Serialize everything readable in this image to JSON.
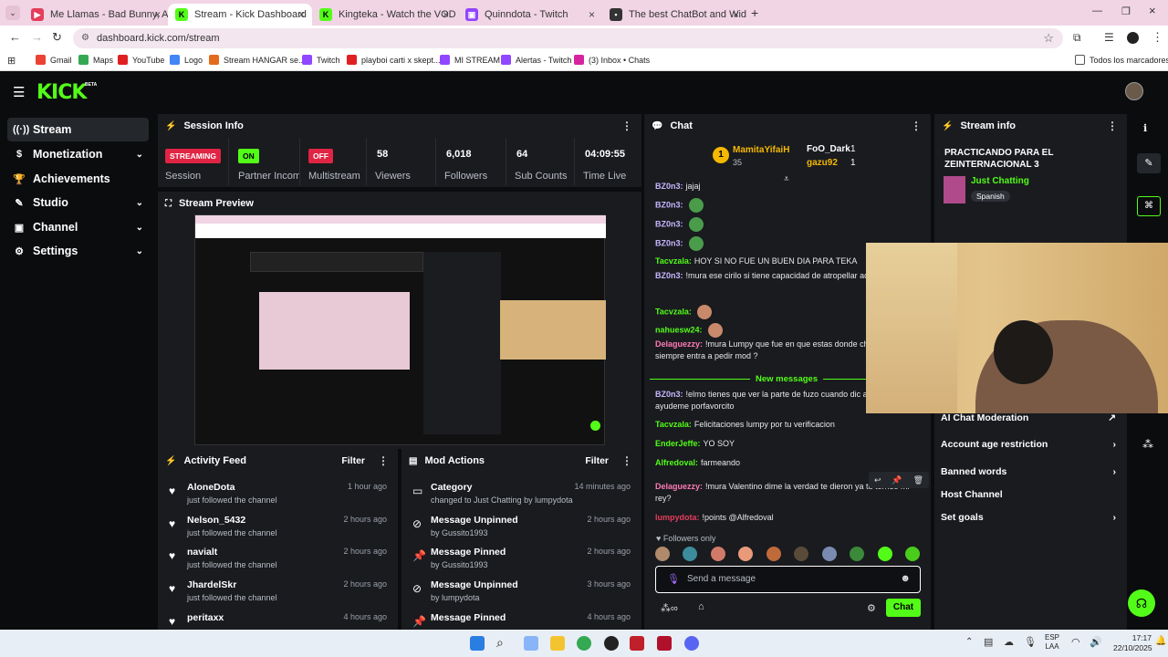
{
  "browser": {
    "tabs": [
      {
        "label": "Me Llamas - Bad Bunny, Arcang",
        "color": "#e43d5b"
      },
      {
        "label": "Stream - Kick Dashboard",
        "color": "#53fc18",
        "active": true
      },
      {
        "label": "Kingteka - Watch the VOD",
        "color": "#53fc18"
      },
      {
        "label": "Quinndota - Twitch",
        "color": "#9146ff"
      },
      {
        "label": "The best ChatBot and Widgets",
        "color": "#333"
      }
    ],
    "url": "dashboard.kick.com/stream",
    "bookmarks": [
      "Gmail",
      "Maps",
      "YouTube",
      "Logo",
      "Stream HANGAR se...",
      "Twitch",
      "playboi carti x skept...",
      "MI STREAM",
      "Alertas - Twitch",
      "(3) Inbox • Chats"
    ],
    "bookmarks_folder": "Todos los marcadores"
  },
  "app": {
    "logo": "KICK",
    "logo_beta": "BETA",
    "sidebar": [
      {
        "label": "Stream",
        "active": true
      },
      {
        "label": "Monetization",
        "chev": true
      },
      {
        "label": "Achievements"
      },
      {
        "label": "Studio",
        "chev": true
      },
      {
        "label": "Channel",
        "chev": true
      },
      {
        "label": "Settings",
        "chev": true
      }
    ],
    "session": {
      "title": "Session Info",
      "stats": [
        {
          "badge": "STREAMING",
          "label": "Session"
        },
        {
          "badge": "ON",
          "label": "Partner Income"
        },
        {
          "badge": "OFF",
          "label": "Multistream"
        },
        {
          "value": "58",
          "label": "Viewers"
        },
        {
          "value": "6,018",
          "label": "Followers"
        },
        {
          "value": "64",
          "label": "Sub Counts"
        },
        {
          "value": "04:09:55",
          "label": "Time Live"
        }
      ]
    },
    "preview_title": "Stream Preview",
    "activity": {
      "title": "Activity Feed",
      "filter": "Filter",
      "rows": [
        {
          "name": "AloneDota",
          "sub": "just followed the channel",
          "time": "1 hour ago"
        },
        {
          "name": "Nelson_5432",
          "sub": "just followed the channel",
          "time": "2 hours ago"
        },
        {
          "name": "navialt",
          "sub": "just followed the channel",
          "time": "2 hours ago"
        },
        {
          "name": "JhardelSkr",
          "sub": "just followed the channel",
          "time": "2 hours ago"
        },
        {
          "name": "peritaxx",
          "sub": "",
          "time": "4 hours ago"
        }
      ]
    },
    "mod": {
      "title": "Mod Actions",
      "filter": "Filter",
      "rows": [
        {
          "name": "Category",
          "sub": "changed to Just Chatting by lumpydota",
          "time": "14 minutes ago"
        },
        {
          "name": "Message Unpinned",
          "sub": "by Gussito1993",
          "time": "2 hours ago"
        },
        {
          "name": "Message Pinned",
          "sub": "by Gussito1993",
          "time": "2 hours ago"
        },
        {
          "name": "Message Unpinned",
          "sub": "by lumpydota",
          "time": "3 hours ago"
        },
        {
          "name": "Message Pinned",
          "sub": "",
          "time": "4 hours ago"
        }
      ]
    },
    "chat": {
      "title": "Chat",
      "leader1": {
        "name": "MamitaYifaiH",
        "count": "35"
      },
      "leader2": {
        "name": "FoO_Dark",
        "count": "1"
      },
      "leader3": {
        "name": "gazu92",
        "count": "1"
      },
      "rank": "1",
      "messages": [
        {
          "user": "BZ0n3:",
          "text": "jajaj",
          "color": "#c8b6ff"
        },
        {
          "user": "BZ0n3:",
          "text": "",
          "color": "#c8b6ff"
        },
        {
          "user": "BZ0n3:",
          "text": "",
          "color": "#c8b6ff"
        },
        {
          "user": "BZ0n3:",
          "text": "",
          "color": "#c8b6ff"
        },
        {
          "user": "Tacvzala:",
          "text": "HOY SI NO FUE UN BUEN DIA PARA TEKA",
          "color": "#53fc18"
        },
        {
          "user": "BZ0n3:",
          "text": "!mura ese cirilo si tiene capacidad de atropellar adeoof",
          "color": "#c8b6ff"
        },
        {
          "user": "Tacvzala:",
          "text": "",
          "color": "#53fc18"
        },
        {
          "user": "nahuesw24:",
          "text": "",
          "color": "#53fc18"
        },
        {
          "user": "Delaguezzy:",
          "text": "!mura Lumpy que fue en que estas donde chupapinga que siempre entra a pedir mod ?",
          "color": "#ff7ab6"
        },
        {
          "user": "BZ0n3:",
          "text": "!elmo tienes que ver la parte de fuzo cuando dic abogada ayudeme porfavorcito",
          "color": "#c8b6ff"
        },
        {
          "user": "Tacvzala:",
          "text": "Felicitaciones lumpy por tu verificacion",
          "color": "#53fc18"
        },
        {
          "user": "EnderJeffe:",
          "text": "YO SOY",
          "color": "#53fc18"
        },
        {
          "user": "Alfredoval:",
          "text": "farmeando",
          "color": "#53fc18"
        },
        {
          "user": "Delaguezzy:",
          "text": "!mura Valentino dime la verdad te dieron ya tu torneo mi rey?",
          "color": "#ff7ab6"
        },
        {
          "user": "lumpydota:",
          "text": "!points @Alfredoval",
          "color": "#e43d5b"
        }
      ],
      "new_messages": "New messages",
      "followers_only": "Followers only",
      "input_placeholder": "Send a message",
      "send": "Chat"
    },
    "stream_info": {
      "title": "Stream info",
      "stream_title": "PRACTICANDO PARA EL ZEINTERNACIONAL 3",
      "category": "Just Chatting",
      "tag": "Spanish",
      "items": [
        {
          "label": "AI Chat Moderation",
          "chev": "↗"
        },
        {
          "label": "Account age restriction",
          "chev": "›"
        },
        {
          "label": "Banned words",
          "chev": "›"
        },
        {
          "label": "Host Channel",
          "chev": ""
        },
        {
          "label": "Set goals",
          "chev": "›"
        }
      ]
    }
  },
  "taskbar": {
    "lang": "ESP",
    "layout": "LAA",
    "time": "17:17",
    "date": "22/10/2025"
  }
}
